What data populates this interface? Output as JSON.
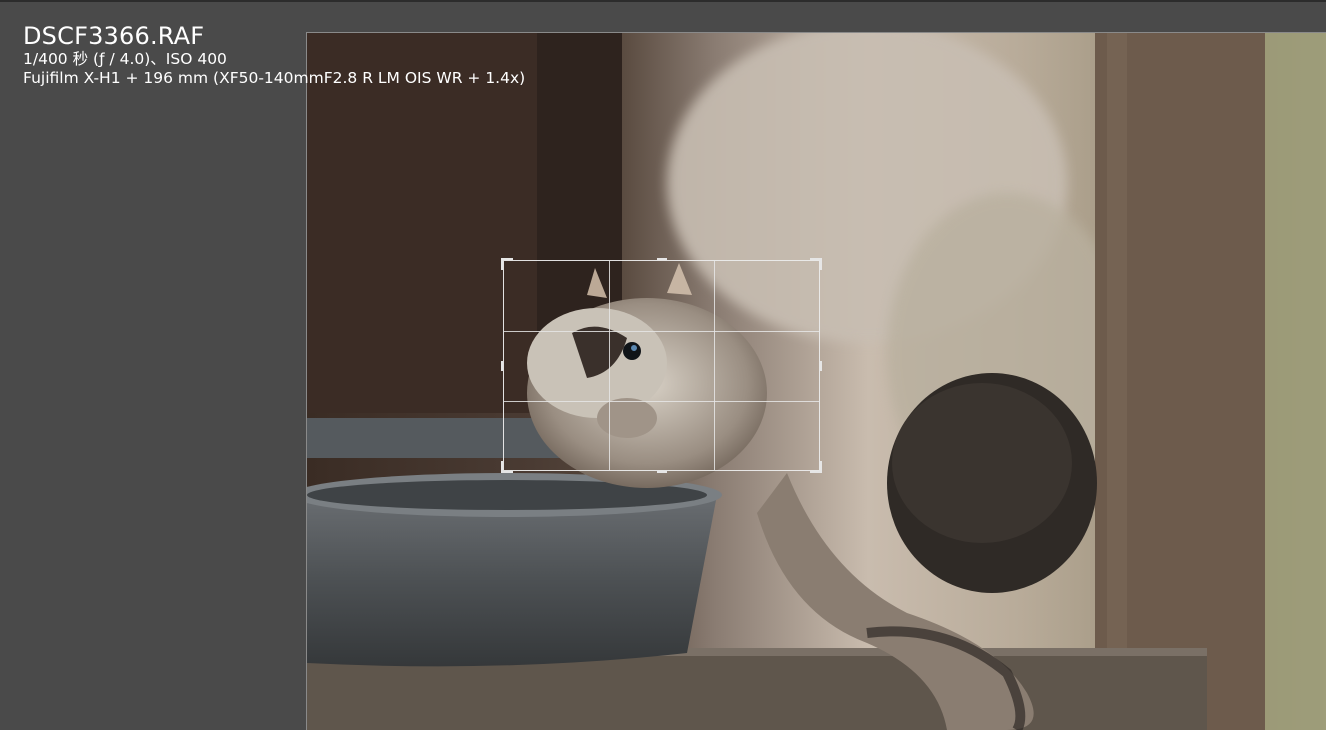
{
  "image": {
    "filename": "DSCF3366.RAF",
    "exposure": "1/400 秒 (ƒ / 4.0)、ISO 400",
    "camera": "Fujifilm X-H1 + 196 mm (XF50-140mmF2.8 R LM OIS WR + 1.4x)"
  },
  "colors": {
    "background": "#4a4a4a",
    "overlay_text": "#ffffff",
    "crop_guide": "#e6e6e6"
  },
  "icons": [
    "crop-corner-handle",
    "crop-edge-handle"
  ]
}
